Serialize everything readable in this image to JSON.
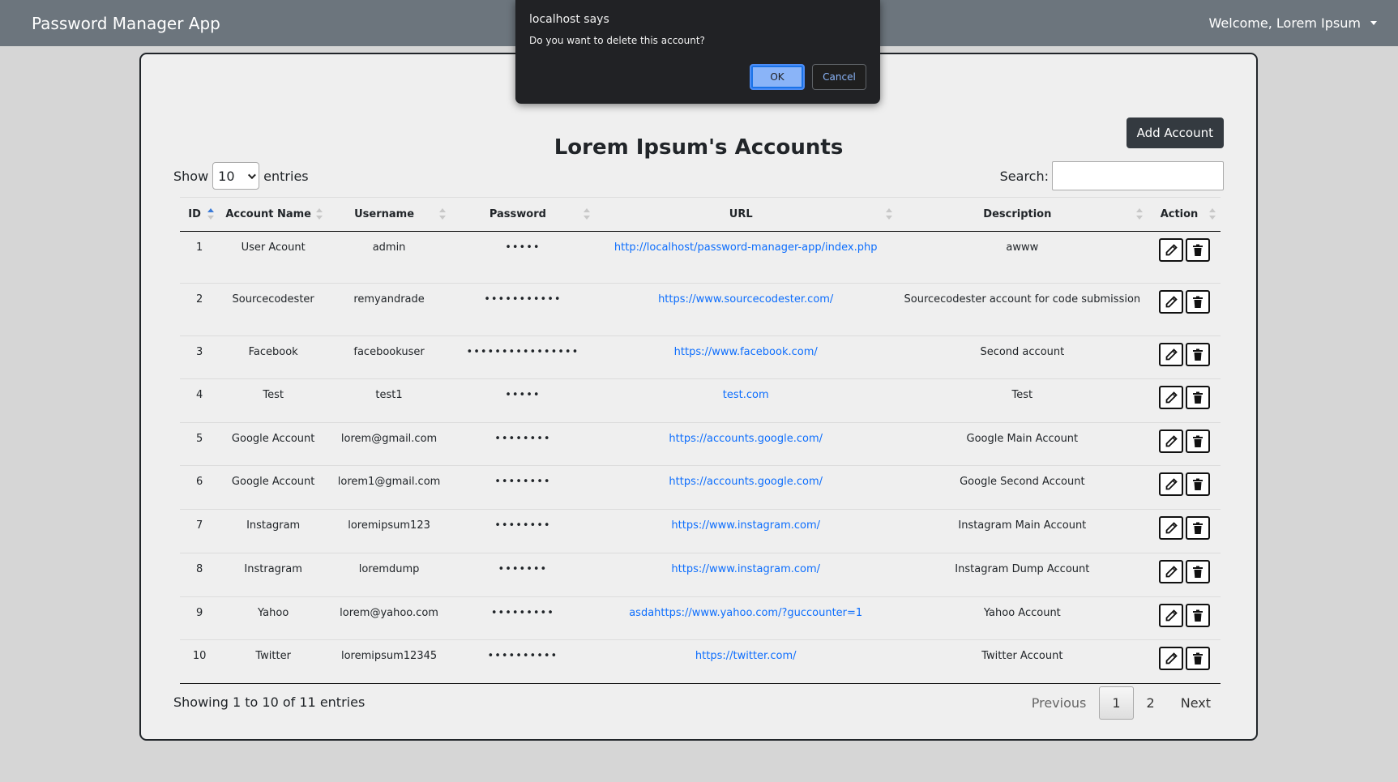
{
  "navbar": {
    "brand": "Password Manager App",
    "welcome": "Welcome, Lorem Ipsum"
  },
  "card": {
    "title": "Lorem Ipsum's Accounts",
    "add_button": "Add Account"
  },
  "length": {
    "show": "Show",
    "value": "10",
    "entries": "entries"
  },
  "search": {
    "label": "Search:",
    "value": ""
  },
  "table": {
    "headers": [
      "ID",
      "Account Name",
      "Username",
      "Password",
      "URL",
      "Description",
      "Action"
    ],
    "rows": [
      {
        "id": "1",
        "name": "User Acount",
        "username": "admin",
        "password": "•••••",
        "url": "http://localhost/password-manager-app/index.php",
        "description": "awww"
      },
      {
        "id": "2",
        "name": "Sourcecodester",
        "username": "remyandrade",
        "password": "•••••••••••",
        "url": "https://www.sourcecodester.com/",
        "description": "Sourcecodester account for code submission"
      },
      {
        "id": "3",
        "name": "Facebook",
        "username": "facebookuser",
        "password": "••••••••••••••••",
        "url": "https://www.facebook.com/",
        "description": "Second account"
      },
      {
        "id": "4",
        "name": "Test",
        "username": "test1",
        "password": "•••••",
        "url": "test.com",
        "description": "Test"
      },
      {
        "id": "5",
        "name": "Google Account",
        "username": "lorem@gmail.com",
        "password": "••••••••",
        "url": "https://accounts.google.com/",
        "description": "Google Main Account"
      },
      {
        "id": "6",
        "name": "Google Account",
        "username": "lorem1@gmail.com",
        "password": "••••••••",
        "url": "https://accounts.google.com/",
        "description": "Google Second Account"
      },
      {
        "id": "7",
        "name": "Instagram",
        "username": "loremipsum123",
        "password": "••••••••",
        "url": "https://www.instagram.com/",
        "description": "Instagram Main Account"
      },
      {
        "id": "8",
        "name": "Instragram",
        "username": "loremdump",
        "password": "•••••••",
        "url": "https://www.instagram.com/",
        "description": "Instagram Dump Account"
      },
      {
        "id": "9",
        "name": "Yahoo",
        "username": "lorem@yahoo.com",
        "password": "•••••••••",
        "url": "asdahttps://www.yahoo.com/?guccounter=1",
        "description": "Yahoo Account"
      },
      {
        "id": "10",
        "name": "Twitter",
        "username": "loremipsum12345",
        "password": "••••••••••",
        "url": "https://twitter.com/",
        "description": "Twitter Account"
      }
    ]
  },
  "footer": {
    "info": "Showing 1 to 10 of 11 entries",
    "previous": "Previous",
    "pages": [
      "1",
      "2"
    ],
    "next": "Next"
  },
  "dialog": {
    "title": "localhost says",
    "message": "Do you want to delete this account?",
    "ok": "OK",
    "cancel": "Cancel"
  },
  "icons": {
    "edit": "pencil-icon",
    "delete": "trash-icon"
  }
}
